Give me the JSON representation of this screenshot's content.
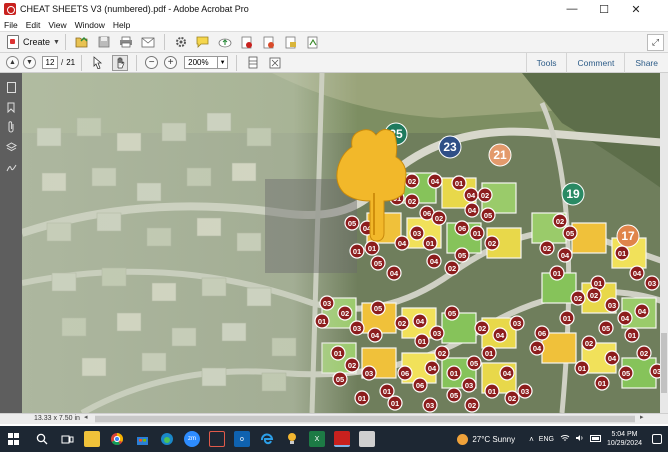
{
  "window": {
    "title": "CHEAT SHEETS V3 (numbered).pdf - Adobe Acrobat Pro",
    "minimize": "—",
    "maximize": "☐",
    "close": "✕"
  },
  "menu": [
    "File",
    "Edit",
    "View",
    "Window",
    "Help"
  ],
  "toolbar": {
    "create_label": "Create",
    "icons": [
      "folder-open-icon",
      "save-icon",
      "print-icon",
      "email-icon",
      "gear-icon",
      "comment-icon",
      "cloud-upload-icon",
      "pdf-form-icon",
      "export-icon",
      "sign-icon"
    ]
  },
  "nav": {
    "current_page": "12",
    "page_separator": "/",
    "total_pages": "21",
    "zoom": "200%"
  },
  "panes": {
    "tools": "Tools",
    "comment": "Comment",
    "share": "Share"
  },
  "status": {
    "page_dimensions": "13.33 x 7.50 in"
  },
  "map": {
    "zone_badges": [
      {
        "label": "25",
        "color": "#1f7a5e"
      },
      {
        "label": "23",
        "color": "#2f4f86"
      },
      {
        "label": "21",
        "color": "#e39a6c"
      },
      {
        "label": "19",
        "color": "#2a8a64"
      },
      {
        "label": "17",
        "color": "#e0844a"
      }
    ],
    "unit_labels": [
      "03",
      "02",
      "02",
      "04",
      "02",
      "01",
      "02",
      "04",
      "05",
      "06",
      "02",
      "05",
      "04",
      "06",
      "01",
      "02",
      "03",
      "01",
      "04",
      "05",
      "02",
      "01",
      "04",
      "01",
      "05",
      "04",
      "02",
      "05",
      "02",
      "04",
      "01",
      "01",
      "02",
      "03",
      "04",
      "02",
      "01",
      "04",
      "05",
      "01",
      "02",
      "03",
      "02",
      "04",
      "05",
      "01",
      "04",
      "03",
      "01",
      "06",
      "01",
      "03",
      "02",
      "01",
      "05",
      "03",
      "04",
      "01",
      "02",
      "03",
      "01",
      "05",
      "02",
      "04",
      "03",
      "01",
      "02",
      "06",
      "06",
      "04",
      "01",
      "03",
      "05",
      "02",
      "04",
      "01",
      "05",
      "04",
      "01",
      "02",
      "03",
      "04",
      "02",
      "03",
      "01",
      "01",
      "03",
      "05",
      "02",
      "04",
      "01"
    ]
  },
  "taskbar": {
    "apps": [
      "search-icon",
      "task-view-icon",
      "file-explorer-icon",
      "chrome-icon",
      "store-icon",
      "edge-icon",
      "zoom-icon",
      "app-icon",
      "outlook-icon",
      "edge-browser-icon",
      "lightbulb-icon",
      "excel-icon",
      "acrobat-icon",
      "install-icon"
    ],
    "weather": "27°C  Sunny",
    "language": "ENG",
    "time": "5:04 PM",
    "date": "10/29/2024"
  },
  "colors": {
    "accent": "#2d5c88",
    "unit_red": "#8c1d1d",
    "taskbar": "#1d2733"
  }
}
